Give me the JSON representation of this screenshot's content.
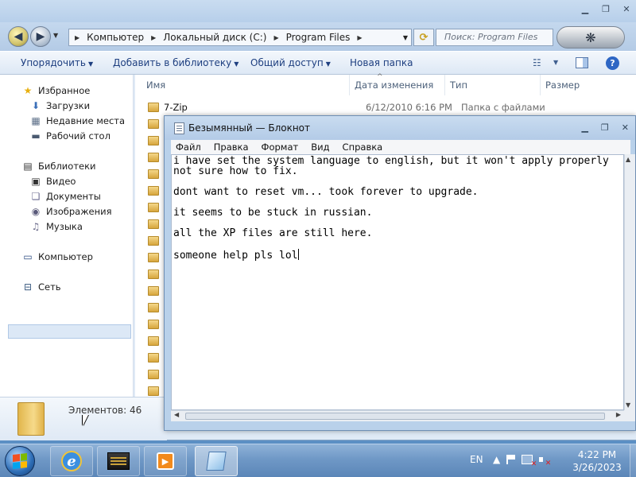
{
  "explorer": {
    "breadcrumb": [
      "Компьютер",
      "Локальный диск (C:)",
      "Program Files"
    ],
    "search_placeholder": "Поиск: Program Files",
    "toolbar": [
      "Упорядочить",
      "Добавить в библиотеку",
      "Общий доступ",
      "Новая папка"
    ],
    "columns": [
      "Имя",
      "Дата изменения",
      "Тип",
      "Размер"
    ],
    "nav": {
      "favorites": "Избранное",
      "favorites_items": [
        "Загрузки",
        "Недавние места",
        "Рабочий стол"
      ],
      "libraries": "Библиотеки",
      "libraries_items": [
        "Видео",
        "Документы",
        "Изображения",
        "Музыка"
      ],
      "computer": "Компьютер",
      "network": "Сеть"
    },
    "first_file": {
      "name": "7-Zip",
      "date": "6/12/2010 6:16 PM",
      "type": "Папка с файлами"
    },
    "item_count": "Элементов: 46"
  },
  "notepad": {
    "title": "Безымянный — Блокнот",
    "menu": [
      "Файл",
      "Правка",
      "Формат",
      "Вид",
      "Справка"
    ],
    "lines": [
      "i have set the system language to english, but it won't apply properly",
      "not sure how to fix.",
      "dont want to reset vm... took forever to upgrade.",
      "it seems to be stuck in russian.",
      "all the XP files are still here.",
      "someone help pls lol"
    ]
  },
  "taskbar": {
    "language": "EN",
    "time": "4:22 PM",
    "date": "3/26/2023"
  },
  "icons": {
    "start": "windows-start-orb",
    "apps": [
      "internet-explorer-icon",
      "explorer-icon",
      "media-player-icon",
      "notepad-icon"
    ]
  }
}
